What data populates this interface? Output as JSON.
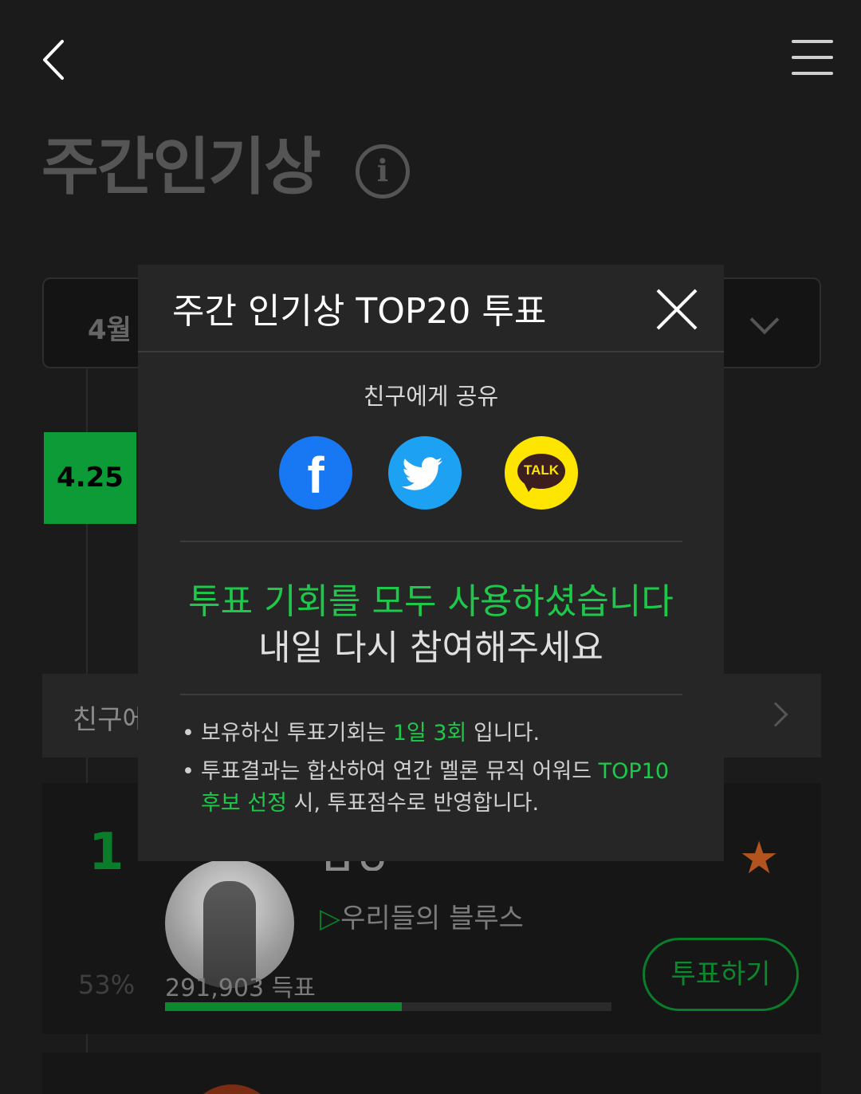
{
  "page": {
    "title": "주간인기상",
    "month_label": "4월",
    "date_badge": "4.25",
    "friends_label": "친구에",
    "rank_card": {
      "rank": "1",
      "artist_name_partial": "ㅁㅇㅇ",
      "song_play_icon": "▷",
      "song": "우리들의 블루스",
      "percent": "53%",
      "vote_count": "291,903 득표",
      "vote_fraction": 0.53,
      "vote_button": "투표하기",
      "star_icon": "★"
    }
  },
  "modal": {
    "title": "주간 인기상 TOP20 투표",
    "share_label": "친구에게 공유",
    "share_buttons": [
      {
        "name": "facebook",
        "glyph": "f"
      },
      {
        "name": "twitter"
      },
      {
        "name": "kakaotalk",
        "glyph": "TALK"
      }
    ],
    "message_green": "투표 기회를 모두 사용하셨습니다",
    "message_white": "내일 다시 참여해주세요",
    "notes": [
      {
        "pre": "보유하신 투표기회는 ",
        "hl": "1일 3회",
        "post": " 입니다."
      },
      {
        "pre": "투표결과는 합산하여 연간 멜론 뮤직 어워드 ",
        "hl": "TOP10 후보 선정",
        "post": " 시, 투표점수로 반영합니다."
      }
    ]
  },
  "colors": {
    "accent_green": "#1dc84b",
    "facebook": "#1877f2",
    "twitter": "#1da1f2",
    "kakao": "#fee500"
  }
}
